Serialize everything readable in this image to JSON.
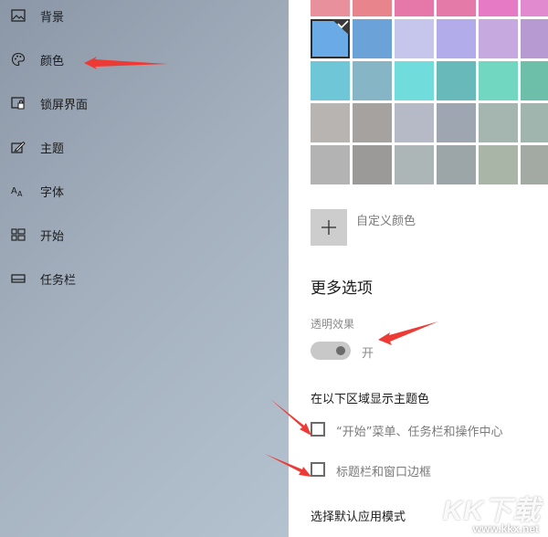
{
  "sidebar": {
    "items": [
      {
        "label": "背景",
        "icon": "image-icon"
      },
      {
        "label": "颜色",
        "icon": "palette-icon"
      },
      {
        "label": "锁屏界面",
        "icon": "lock-screen-icon"
      },
      {
        "label": "主题",
        "icon": "theme-brush-icon"
      },
      {
        "label": "字体",
        "icon": "font-icon"
      },
      {
        "label": "开始",
        "icon": "start-grid-icon"
      },
      {
        "label": "任务栏",
        "icon": "taskbar-icon"
      }
    ],
    "selected": "颜色"
  },
  "colors": {
    "rows": [
      [
        "#e8909c",
        "#e8848c",
        "#e678a9",
        "#e37aa8",
        "#e67ac4",
        "#e28ad0"
      ],
      [
        "#6aabe7",
        "#6ba3d9",
        "#c6c6ec",
        "#b2acea",
        "#c6a9df",
        "#b89ad2"
      ],
      [
        "#6fc6d6",
        "#86b6c6",
        "#70dcdc",
        "#68b9ba",
        "#72d7c1",
        "#6ebfaa"
      ],
      [
        "#b8b4b2",
        "#a5a29f",
        "#b5bac6",
        "#9ea7b1",
        "#a5b5b0",
        "#a0b5ae"
      ],
      [
        "#b3b3b3",
        "#9c9a99",
        "#adb6b6",
        "#9ca5a8",
        "#a9b5a6",
        "#a2aaa3"
      ]
    ],
    "selected_row": 1,
    "selected_col": 0,
    "accent": "#6aabe7"
  },
  "custom_color": {
    "label": "自定义颜色",
    "icon": "plus-icon"
  },
  "more_options": {
    "title": "更多选项",
    "transparency_label": "透明效果",
    "transparency_state": "开",
    "accent_surfaces_heading": "在以下区域显示主题色",
    "checkboxes": [
      {
        "label": "“开始”菜单、任务栏和操作中心",
        "checked": false
      },
      {
        "label": "标题栏和窗口边框",
        "checked": false
      }
    ],
    "app_mode_heading": "选择默认应用模式"
  },
  "watermark": {
    "logo": "KK下载",
    "url": "www.kkx.net"
  },
  "annotation_color": "#ee3a35"
}
